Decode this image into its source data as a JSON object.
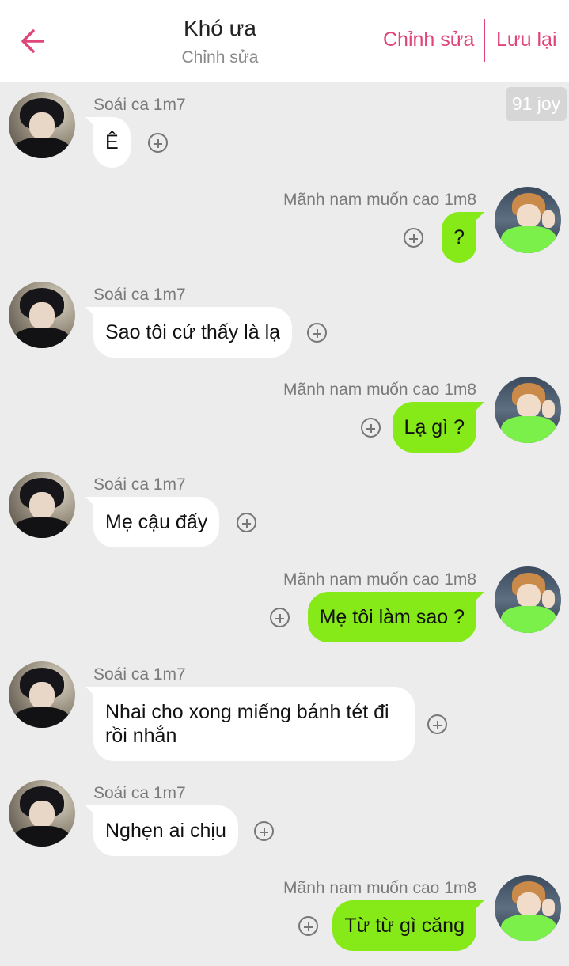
{
  "header": {
    "title": "Khó ưa",
    "subtitle": "Chỉnh sửa",
    "edit_label": "Chỉnh sửa",
    "save_label": "Lưu lại",
    "back_icon": "arrow-left-icon",
    "accent_color": "#e0457a"
  },
  "badge": {
    "joy": "91 joy"
  },
  "users": {
    "left": "Soái ca 1m7",
    "right": "Mãnh nam muốn cao 1m8"
  },
  "colors": {
    "left_bubble": "#ffffff",
    "right_bubble": "#86ea18",
    "background": "#ececec"
  },
  "messages": [
    {
      "side": "left",
      "sender": "Soái ca 1m7",
      "text": "Ê"
    },
    {
      "side": "right",
      "sender": "Mãnh nam muốn cao 1m8",
      "text": "?"
    },
    {
      "side": "left",
      "sender": "Soái ca 1m7",
      "text": "Sao tôi cứ thấy là lạ"
    },
    {
      "side": "right",
      "sender": "Mãnh nam muốn cao 1m8",
      "text": "Lạ gì ?"
    },
    {
      "side": "left",
      "sender": "Soái ca 1m7",
      "text": "Mẹ cậu đấy"
    },
    {
      "side": "right",
      "sender": "Mãnh nam muốn cao 1m8",
      "text": "Mẹ tôi làm sao ?"
    },
    {
      "side": "left",
      "sender": "Soái ca 1m7",
      "text": "Nhai cho xong miếng bánh tét đi rồi nhắn"
    },
    {
      "side": "left",
      "sender": "Soái ca 1m7",
      "text": "Nghẹn ai chịu"
    },
    {
      "side": "right",
      "sender": "Mãnh nam muốn cao 1m8",
      "text": "Từ từ gì căng"
    }
  ]
}
